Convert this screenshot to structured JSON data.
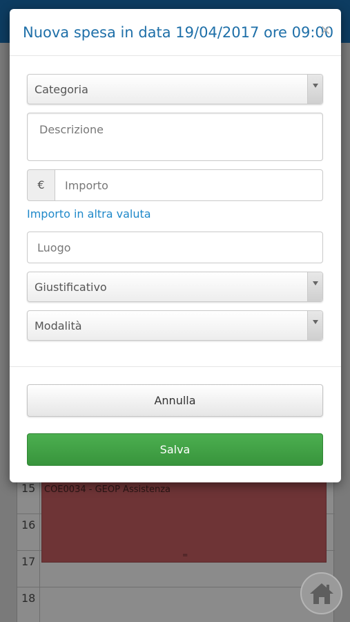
{
  "modal": {
    "title": "Nuova spesa in data 19/04/2017 ore 09:00",
    "close_label": "×",
    "fields": {
      "categoria_placeholder": "Categoria",
      "descrizione_placeholder": "Descrizione",
      "currency_symbol": "€",
      "importo_placeholder": "Importo",
      "other_currency_link": "Importo in altra valuta",
      "luogo_placeholder": "Luogo",
      "giustificativo_placeholder": "Giustificativo",
      "modalita_placeholder": "Modalità"
    },
    "buttons": {
      "cancel": "Annulla",
      "save": "Salva"
    }
  },
  "background": {
    "calendar": {
      "hours": [
        "15",
        "16",
        "17",
        "18"
      ],
      "event": "COE0034 - GEOP Assistenza"
    }
  },
  "colors": {
    "title": "#1e6fa8",
    "link": "#1e88c9",
    "save_button": "#43a047",
    "header_bar": "#0d3c61",
    "event_block": "#6e3436"
  },
  "icons": {
    "close": "close-icon",
    "home": "home-icon",
    "dropdown": "chevron-down-icon"
  }
}
